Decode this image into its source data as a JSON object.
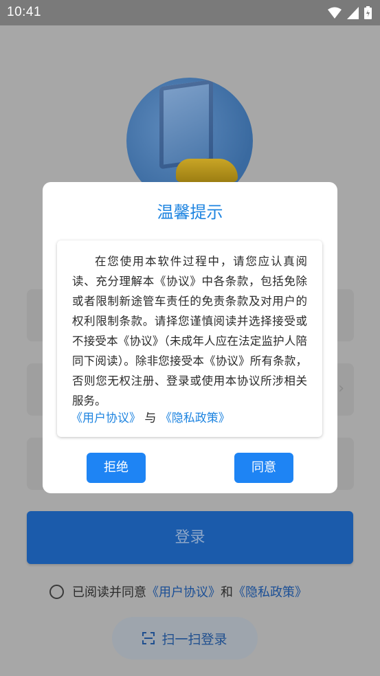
{
  "status_bar": {
    "time": "10:41"
  },
  "login_button": {
    "label": "登录"
  },
  "agreement": {
    "prefix": "已阅读并同意",
    "user_agreement": "《用户协议》",
    "and": "和",
    "privacy_policy": "《隐私政策》"
  },
  "scan_login": {
    "label": "扫一扫登录"
  },
  "dialog": {
    "title": "温馨提示",
    "body": "在您使用本软件过程中，请您应认真阅读、充分理解本《协议》中各条款，包括免除或者限制新途管车责任的免责条款及对用户的权利限制条款。请择您谨慎阅读并选择接受或不接受本《协议》（未成年人应在法定监护人陪同下阅读）。除非您接受本《协议》所有条款，否则您无权注册、登录或使用本协议所涉相关服务。",
    "user_agreement_link": "《用户协议》",
    "joiner": "与",
    "privacy_policy_link": "《隐私政策》",
    "reject_label": "拒绝",
    "accept_label": "同意"
  },
  "colors": {
    "accent": "#1e84e0",
    "button": "#1e84f4",
    "overlay": "#a7a7a7"
  }
}
